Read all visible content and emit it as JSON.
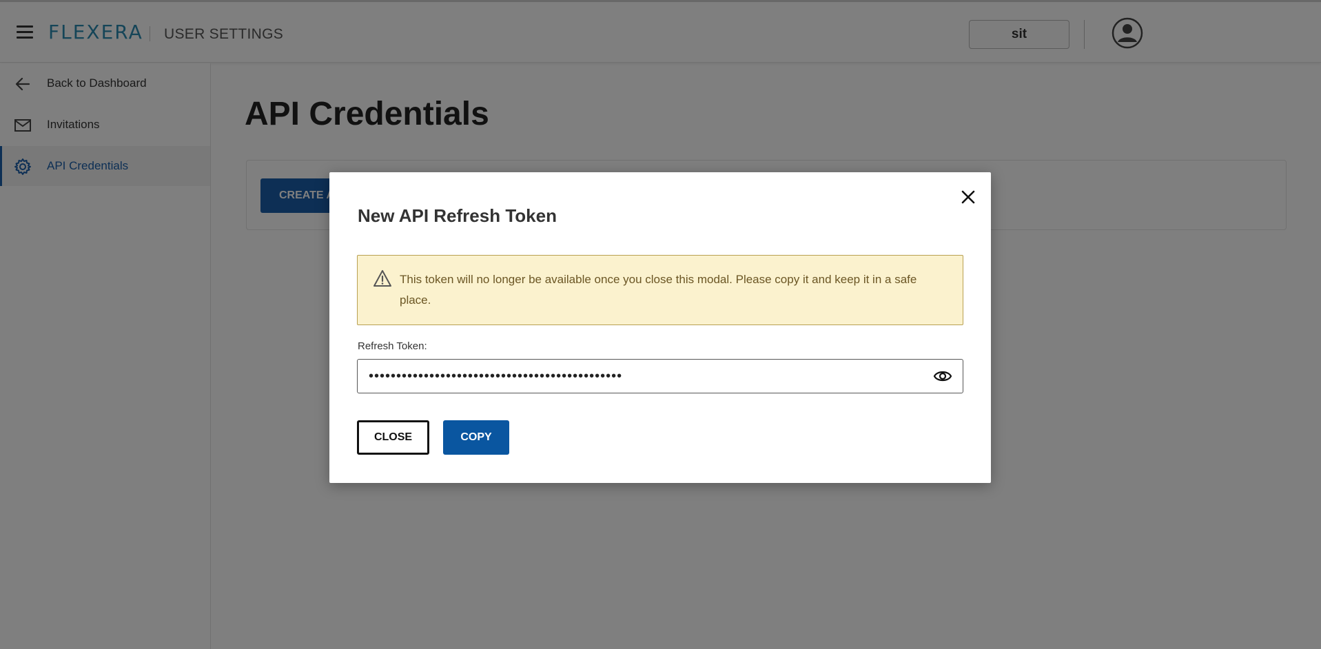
{
  "header": {
    "brand": "FLEXERA",
    "app_title": "USER SETTINGS",
    "env_label": "sit"
  },
  "sidebar": {
    "items": [
      {
        "label": "Back to Dashboard",
        "icon": "arrow-left-icon"
      },
      {
        "label": "Invitations",
        "icon": "mail-icon"
      },
      {
        "label": "API Credentials",
        "icon": "gear-icon",
        "active": true
      }
    ]
  },
  "main": {
    "page_title": "API Credentials",
    "create_button_label": "CREATE A"
  },
  "modal": {
    "title": "New API Refresh Token",
    "alert_text": "This token will no longer be available once you close this modal. Please copy it and keep it in a safe place.",
    "field_label": "Refresh Token:",
    "token_masked": "••••••••••••••••••••••••••••••••••••••••••••••",
    "close_label": "CLOSE",
    "copy_label": "COPY"
  },
  "colors": {
    "brand_blue": "#1a5faa",
    "logo_teal": "#2a8ab0",
    "alert_bg": "#fbf2ce",
    "alert_border": "#b8a050",
    "alert_text": "#6b5624"
  }
}
